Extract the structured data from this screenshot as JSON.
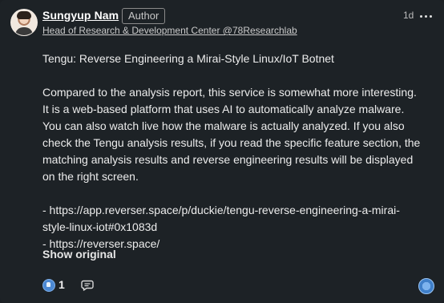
{
  "post": {
    "author_name": "Sungyup Nam",
    "author_badge": "Author",
    "headline": "Head of Research & Development Center @78Researchlab",
    "timestamp": "1d",
    "title_line": "Tengu: Reverse Engineering a Mirai-Style Linux/IoT Botnet",
    "paragraph": "Compared to the analysis report, this service is somewhat more interesting. It is a web-based platform that uses AI to automatically analyze malware. You can also watch live how the malware is actually analyzed. If you also check the Tengu analysis results, if you read the specific feature section, the matching analysis results and reverse engineering results will be displayed on the right screen.",
    "link_1": "- https://app.reverser.space/p/duckie/tengu-reverse-engineering-a-mirai-style-linux-iot#0x1083d",
    "link_2": "- https://reverser.space/",
    "show_original": "Show original"
  },
  "footer": {
    "reaction_count": "1"
  },
  "icons": {
    "more": "more-horizontal-icon",
    "reaction": "like-reaction-icon",
    "comment": "comment-icon",
    "react": "react-icon"
  },
  "colors": {
    "background": "#1d2226",
    "text": "#ececec",
    "reaction_blue": "#4b88d3"
  }
}
